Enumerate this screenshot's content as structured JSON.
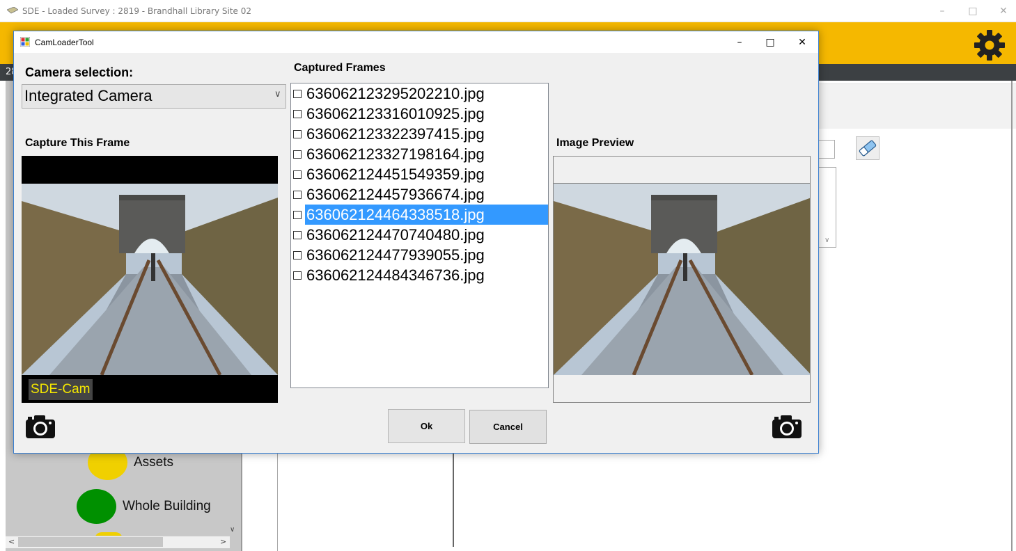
{
  "background_app": {
    "title": "SDE - Loaded Survey : 2819 - Brandhall Library Site 02",
    "strip_number": "28",
    "tree_items": [
      {
        "label": "Assets",
        "color": "#f0d000"
      },
      {
        "label": "Whole Building",
        "color": "#009000"
      }
    ],
    "toolbar_color": "#f5b800"
  },
  "dialog": {
    "title": "CamLoaderTool",
    "camera_selection_label": "Camera selection:",
    "camera_selected": "Integrated Camera",
    "capture_label": "Capture This Frame",
    "frames_label": "Captured Frames",
    "preview_label": "Image Preview",
    "watermark": "SDE-Cam",
    "ok_label": "Ok",
    "cancel_label": "Cancel",
    "selection_color": "#3399ff",
    "frames": [
      {
        "name": "636062123295202210.jpg",
        "selected": false
      },
      {
        "name": "636062123316010925.jpg",
        "selected": false
      },
      {
        "name": "636062123322397415.jpg",
        "selected": false
      },
      {
        "name": "636062123327198164.jpg",
        "selected": false
      },
      {
        "name": "636062124451549359.jpg",
        "selected": false
      },
      {
        "name": "636062124457936674.jpg",
        "selected": false
      },
      {
        "name": "636062124464338518.jpg",
        "selected": true
      },
      {
        "name": "636062124470740480.jpg",
        "selected": false
      },
      {
        "name": "636062124477939055.jpg",
        "selected": false
      },
      {
        "name": "636062124484346736.jpg",
        "selected": false
      }
    ]
  },
  "icons": {
    "settings": "gear-icon",
    "eraser": "eraser-icon",
    "capture": "camera-icon",
    "preview_capture": "camera-icon"
  }
}
